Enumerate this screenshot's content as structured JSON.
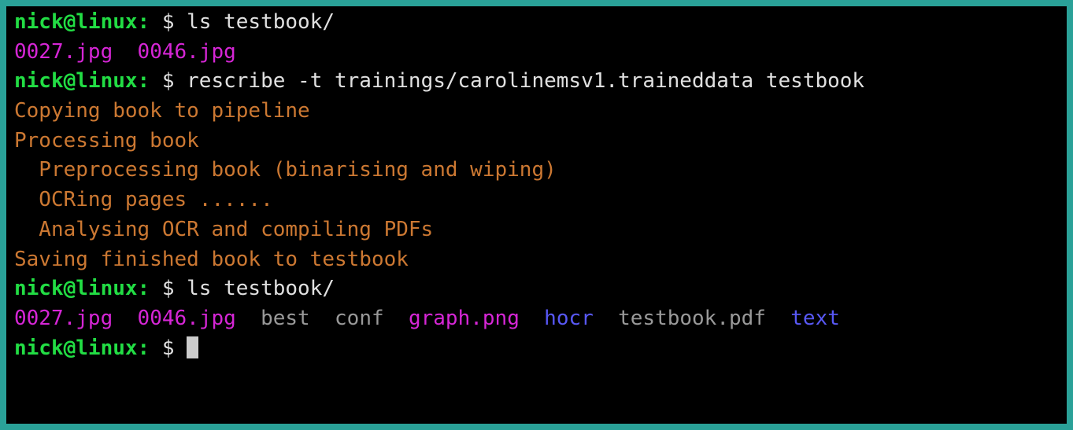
{
  "prompt": {
    "user_host": "nick@linux:",
    "symbol": "$"
  },
  "commands": {
    "ls1": "ls testbook/",
    "rescribe": "rescribe -t trainings/carolinemsv1.traineddata testbook",
    "ls2": "ls testbook/"
  },
  "output": {
    "ls1_files": {
      "f1": "0027.jpg",
      "f2": "0046.jpg"
    },
    "progress": {
      "copying": "Copying book to pipeline",
      "processing": "Processing book",
      "preprocessing": "  Preprocessing book (binarising and wiping)",
      "ocring": "  OCRing pages ......",
      "analysing": "  Analysing OCR and compiling PDFs",
      "saving": "Saving finished book to testbook"
    },
    "ls2_files": {
      "f1": "0027.jpg",
      "f2": "0046.jpg",
      "f3": "best",
      "f4": "conf",
      "f5": "graph.png",
      "f6": "hocr",
      "f7": "testbook.pdf",
      "f8": "text"
    }
  }
}
